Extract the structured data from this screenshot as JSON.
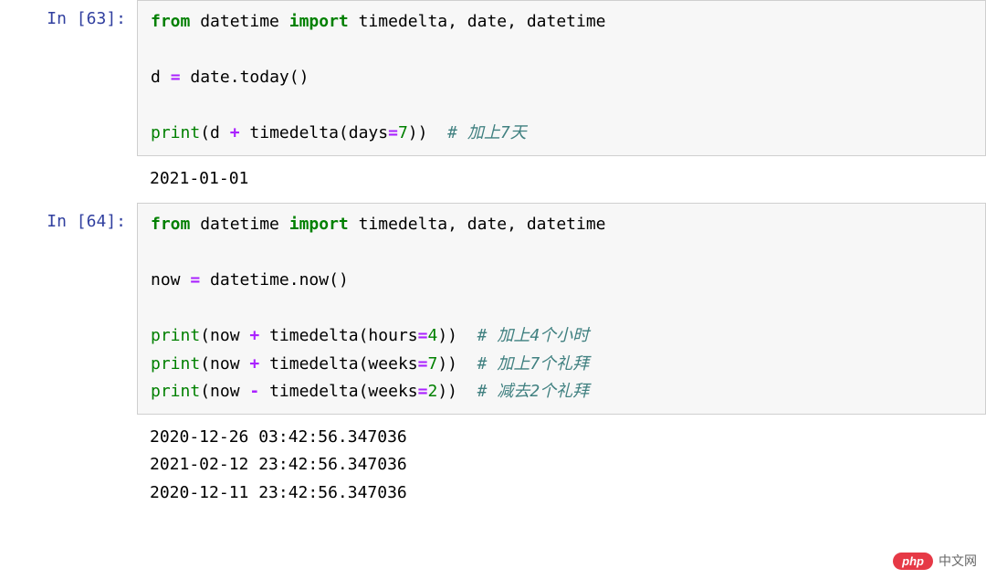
{
  "cells": [
    {
      "prompt": "In [63]:",
      "code_tokens": [
        [
          [
            "from ",
            "kw"
          ],
          [
            "datetime ",
            "nn"
          ],
          [
            "import ",
            "kw"
          ],
          [
            "timedelta, date, datetime",
            "nn"
          ]
        ],
        [],
        [
          [
            "d ",
            "nn"
          ],
          [
            "= ",
            "op"
          ],
          [
            "date",
            "nn"
          ],
          [
            ".",
            "nn"
          ],
          [
            "today()",
            "nn"
          ]
        ],
        [],
        [
          [
            "print",
            "builtin"
          ],
          [
            "(d ",
            "nn"
          ],
          [
            "+ ",
            "op"
          ],
          [
            "timedelta(days",
            "nn"
          ],
          [
            "=",
            "op"
          ],
          [
            "7",
            "num"
          ],
          [
            "))  ",
            "nn"
          ],
          [
            "# 加上7天",
            "comment"
          ]
        ]
      ],
      "output": "2021-01-01"
    },
    {
      "prompt": "In [64]:",
      "code_tokens": [
        [
          [
            "from ",
            "kw"
          ],
          [
            "datetime ",
            "nn"
          ],
          [
            "import ",
            "kw"
          ],
          [
            "timedelta, date, datetime",
            "nn"
          ]
        ],
        [],
        [
          [
            "now ",
            "nn"
          ],
          [
            "= ",
            "op"
          ],
          [
            "datetime",
            "nn"
          ],
          [
            ".",
            "nn"
          ],
          [
            "now()",
            "nn"
          ]
        ],
        [],
        [
          [
            "print",
            "builtin"
          ],
          [
            "(now ",
            "nn"
          ],
          [
            "+ ",
            "op"
          ],
          [
            "timedelta(hours",
            "nn"
          ],
          [
            "=",
            "op"
          ],
          [
            "4",
            "num"
          ],
          [
            "))  ",
            "nn"
          ],
          [
            "# 加上4个小时",
            "comment"
          ]
        ],
        [
          [
            "print",
            "builtin"
          ],
          [
            "(now ",
            "nn"
          ],
          [
            "+ ",
            "op"
          ],
          [
            "timedelta(weeks",
            "nn"
          ],
          [
            "=",
            "op"
          ],
          [
            "7",
            "num"
          ],
          [
            "))  ",
            "nn"
          ],
          [
            "# 加上7个礼拜",
            "comment"
          ]
        ],
        [
          [
            "print",
            "builtin"
          ],
          [
            "(now ",
            "nn"
          ],
          [
            "- ",
            "op"
          ],
          [
            "timedelta(weeks",
            "nn"
          ],
          [
            "=",
            "op"
          ],
          [
            "2",
            "num"
          ],
          [
            "))  ",
            "nn"
          ],
          [
            "# 减去2个礼拜",
            "comment"
          ]
        ]
      ],
      "output": "2020-12-26 03:42:56.347036\n2021-02-12 23:42:56.347036\n2020-12-11 23:42:56.347036"
    }
  ],
  "watermark": {
    "badge": "php",
    "text": "中文网"
  }
}
